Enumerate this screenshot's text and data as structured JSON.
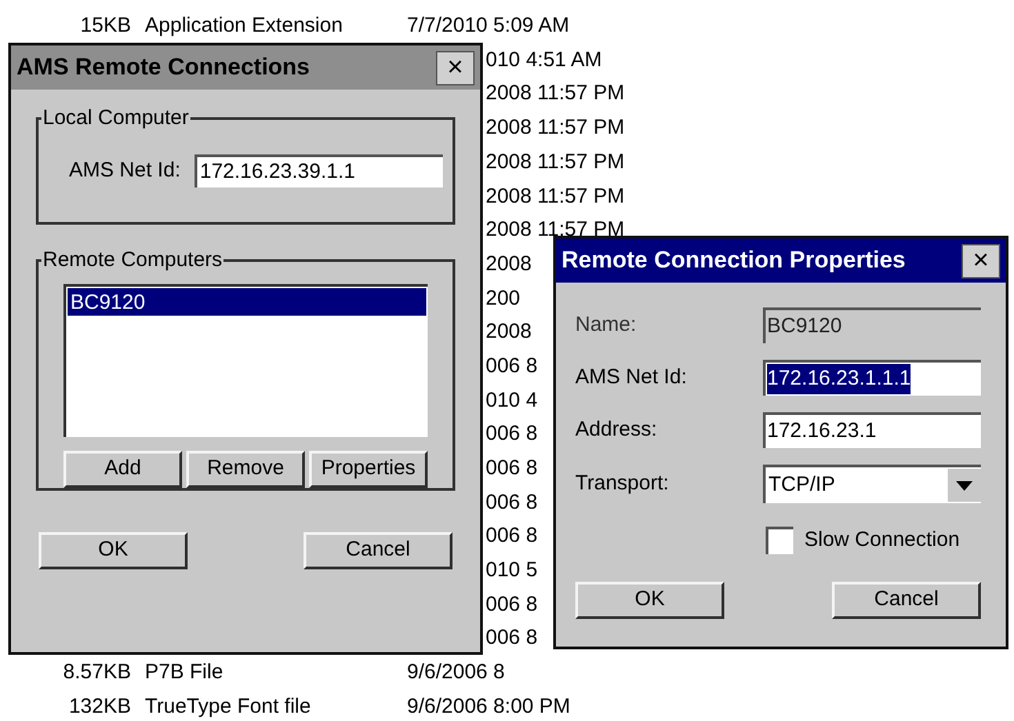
{
  "file_list": [
    {
      "kind": "full",
      "size": "15KB",
      "type": "Application Extension",
      "date": "7/7/2010 5:09 AM"
    },
    {
      "kind": "fragment",
      "text": "010 4:51 AM"
    },
    {
      "kind": "fragment",
      "text": "2008 11:57 PM"
    },
    {
      "kind": "fragment",
      "text": "2008 11:57 PM"
    },
    {
      "kind": "fragment",
      "text": "2008 11:57 PM"
    },
    {
      "kind": "fragment",
      "text": "2008 11:57 PM"
    },
    {
      "kind": "fragment",
      "text": "2008 11:57 PM"
    },
    {
      "kind": "fragment",
      "text": "2008"
    },
    {
      "kind": "fragment",
      "text": "200"
    },
    {
      "kind": "fragment",
      "text": "2008"
    },
    {
      "kind": "fragment",
      "text": "006 8"
    },
    {
      "kind": "fragment",
      "text": "010 4"
    },
    {
      "kind": "fragment",
      "text": "006 8"
    },
    {
      "kind": "fragment",
      "text": "006 8"
    },
    {
      "kind": "fragment",
      "text": "006 8"
    },
    {
      "kind": "fragment",
      "text": "006 8"
    },
    {
      "kind": "fragment",
      "text": "010 5"
    },
    {
      "kind": "fragment",
      "text": "006 8"
    },
    {
      "kind": "fragment",
      "text": "006 8"
    },
    {
      "kind": "full",
      "size": "8.57KB",
      "type": "P7B File",
      "date": "9/6/2006 8"
    },
    {
      "kind": "full",
      "size": "132KB",
      "type": "TrueType Font file",
      "date": "9/6/2006 8:00 PM"
    }
  ],
  "remote_connections": {
    "title": "AMS Remote Connections",
    "active": false,
    "close": "×",
    "local_group": {
      "title": "Local Computer",
      "label": "AMS Net Id:",
      "value": "172.16.23.39.1.1"
    },
    "remote_group": {
      "title": "Remote Computers",
      "items": [
        {
          "label": "BC9120",
          "selected": true
        }
      ],
      "buttons": [
        "Add",
        "Remove",
        "Properties"
      ]
    },
    "buttons": [
      "OK",
      "Cancel"
    ]
  },
  "properties": {
    "title": "Remote Connection Properties",
    "active": true,
    "close": "×",
    "fields": [
      {
        "kind": "text",
        "label": "Name:",
        "value": "BC9120",
        "disabled": true,
        "text_selected": false
      },
      {
        "kind": "text",
        "label": "AMS Net Id:",
        "value": "172.16.23.1.1.1",
        "disabled": false,
        "text_selected": true
      },
      {
        "kind": "text",
        "label": "Address:",
        "value": "172.16.23.1",
        "disabled": false,
        "text_selected": false
      },
      {
        "kind": "dropdown",
        "label": "Transport:",
        "value": "TCP/IP"
      }
    ],
    "checkbox": {
      "label": "Slow Connection",
      "checked": false
    },
    "buttons": [
      "OK",
      "Cancel"
    ]
  }
}
